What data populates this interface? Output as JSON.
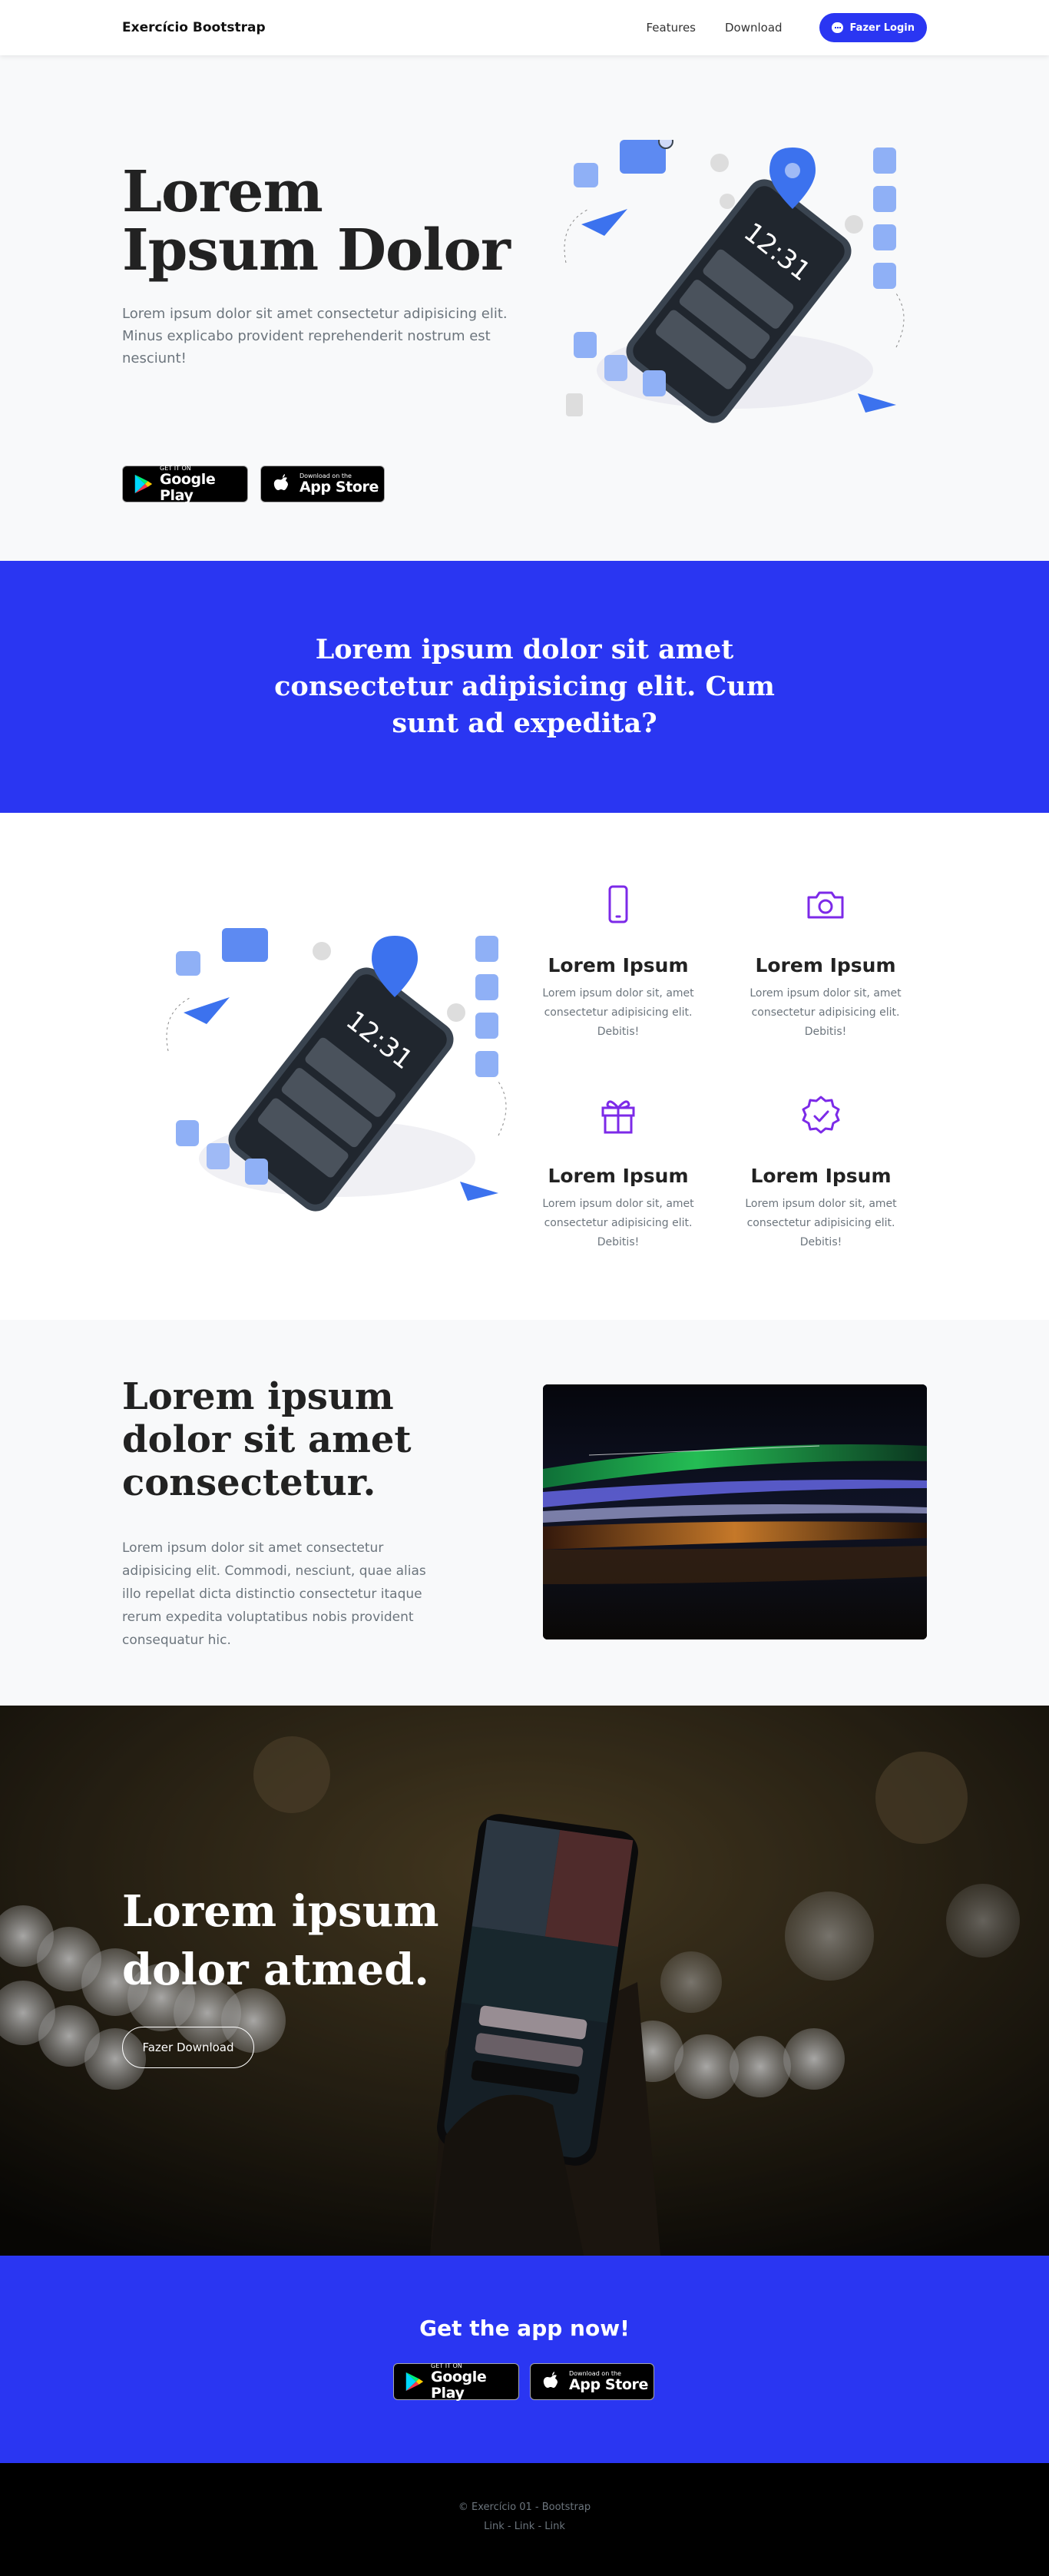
{
  "navbar": {
    "brand": "Exercício Bootstrap",
    "links": [
      "Features",
      "Download"
    ],
    "login_label": "Fazer Login"
  },
  "hero": {
    "title": "Lorem Ipsum Dolor",
    "text": "Lorem ipsum dolor sit amet consectetur adipisicing elit. Minus explicabo provident reprehenderit nostrum est nesciunt!",
    "phone_time": "12:31"
  },
  "stores": {
    "google_small": "GET IT ON",
    "google_big": "Google Play",
    "apple_small": "Download on the",
    "apple_big": "App Store"
  },
  "band": {
    "text": "Lorem ipsum dolor sit amet consectetur adipisicing elit. Cum sunt ad expedita?"
  },
  "features": {
    "phone_time": "12:31",
    "items": [
      {
        "icon": "phone-icon",
        "title": "Lorem Ipsum",
        "text": "Lorem ipsum dolor sit, amet consectetur adipisicing elit. Debitis!"
      },
      {
        "icon": "camera-icon",
        "title": "Lorem Ipsum",
        "text": "Lorem ipsum dolor sit, amet consectetur adipisicing elit. Debitis!"
      },
      {
        "icon": "gift-icon",
        "title": "Lorem Ipsum",
        "text": "Lorem ipsum dolor sit, amet consectetur adipisicing elit. Debitis!"
      },
      {
        "icon": "badge-check-icon",
        "title": "Lorem Ipsum",
        "text": "Lorem ipsum dolor sit, amet consectetur adipisicing elit. Debitis!"
      }
    ]
  },
  "content": {
    "title": "Lorem ipsum dolor sit amet consectetur.",
    "text": "Lorem ipsum dolor sit amet consectetur adipisicing elit. Commodi, nesciunt, quae alias illo repellat dicta distinctio consectetur itaque rerum expedita voluptatibus nobis provident consequatur hic."
  },
  "photo": {
    "title": "Lorem ipsum dolor atmed.",
    "button": "Fazer Download"
  },
  "getapp": {
    "title": "Get the app now!"
  },
  "footer": {
    "copy": "© Exercício 01 - Bootstrap",
    "links": [
      "Link",
      "Link",
      "Link"
    ],
    "separator": " - "
  },
  "colors": {
    "primary": "#2a36f2",
    "light_bg": "#f8f9fa",
    "footer_bg": "#000000",
    "muted_text": "#6c757d",
    "icon_purple": "#7c2ae8"
  }
}
